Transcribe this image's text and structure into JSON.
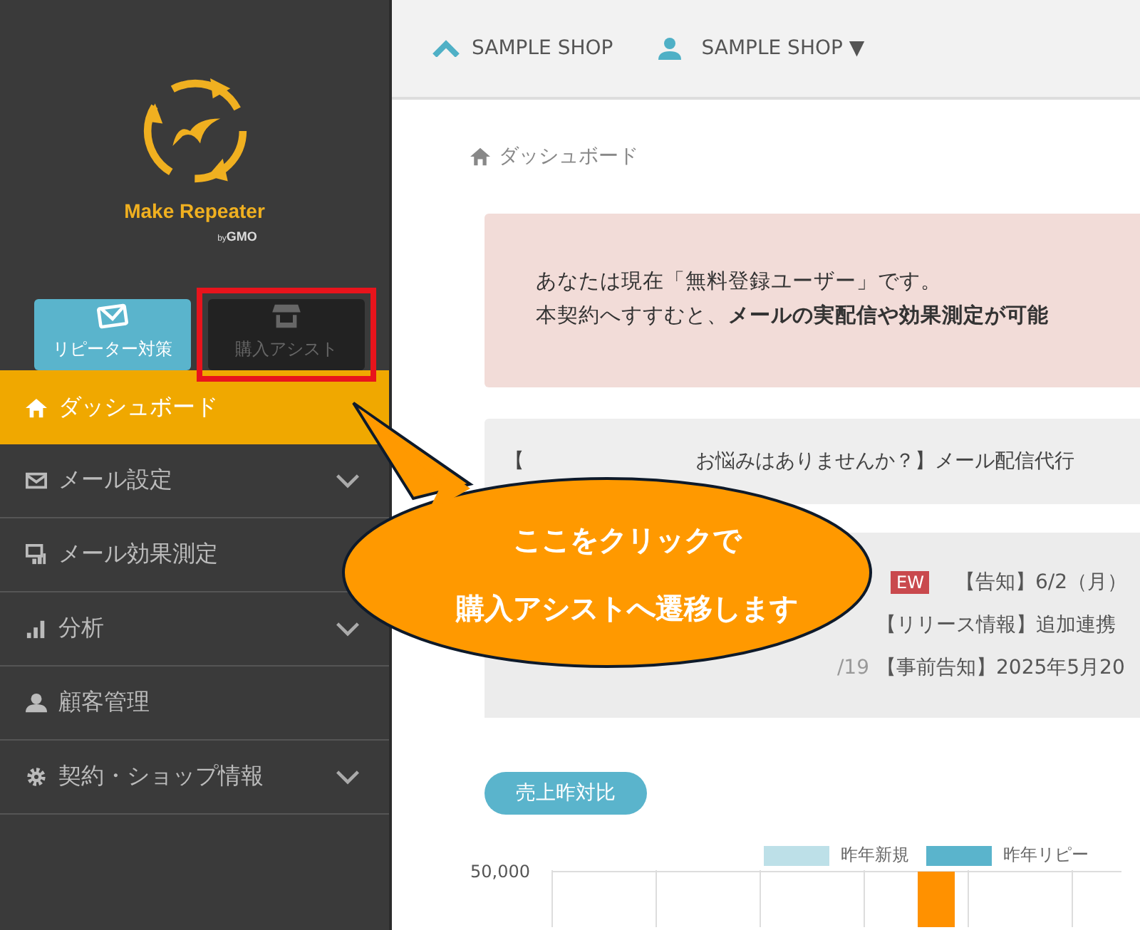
{
  "header": {
    "shop_link": "SAMPLE SHOP",
    "account_menu": "SAMPLE SHOP",
    "caret": "▼"
  },
  "sidebar": {
    "logo": {
      "name": "Make Repeater",
      "by": "by",
      "company": "GMO"
    },
    "mode_buttons": [
      {
        "label": "リピーター対策",
        "selected": true,
        "highlighted": false
      },
      {
        "label": "購入アシスト",
        "selected": false,
        "highlighted": true
      }
    ],
    "menu": [
      {
        "label": "ダッシュボード",
        "selected": true,
        "expandable": false
      },
      {
        "label": "メール設定",
        "selected": false,
        "expandable": true
      },
      {
        "label": "メール効果測定",
        "selected": false,
        "expandable": false
      },
      {
        "label": "分析",
        "selected": false,
        "expandable": true
      },
      {
        "label": "顧客管理",
        "selected": false,
        "expandable": false
      },
      {
        "label": "契約・ショップ情報",
        "selected": false,
        "expandable": true
      }
    ]
  },
  "breadcrumb": "ダッシュボード",
  "notice": {
    "line1": "あなたは現在「無料登録ユーザー」です。",
    "line2": "本契約へすすむと、**メールの実配信や効果測定が可能**"
  },
  "banner": {
    "prefix": "【",
    "text": "お悩みはありませんか？】メール配信代行"
  },
  "news": [
    {
      "badge": "EW",
      "title": "【告知】6/2（月）"
    },
    {
      "title": "【リリース情報】追加連携"
    },
    {
      "date": "/19",
      "title": "【事前告知】2025年5月20"
    }
  ],
  "sales": {
    "button": "売上昨対比",
    "legend": [
      {
        "label": "昨年新規",
        "color": "#bde0e8"
      },
      {
        "label": "昨年リピー",
        "color": "#5ab4cc"
      }
    ],
    "y_tick": "50,000"
  },
  "callout": {
    "lines": [
      "ここをクリックで",
      "購入アシストへ遷移します"
    ]
  }
}
